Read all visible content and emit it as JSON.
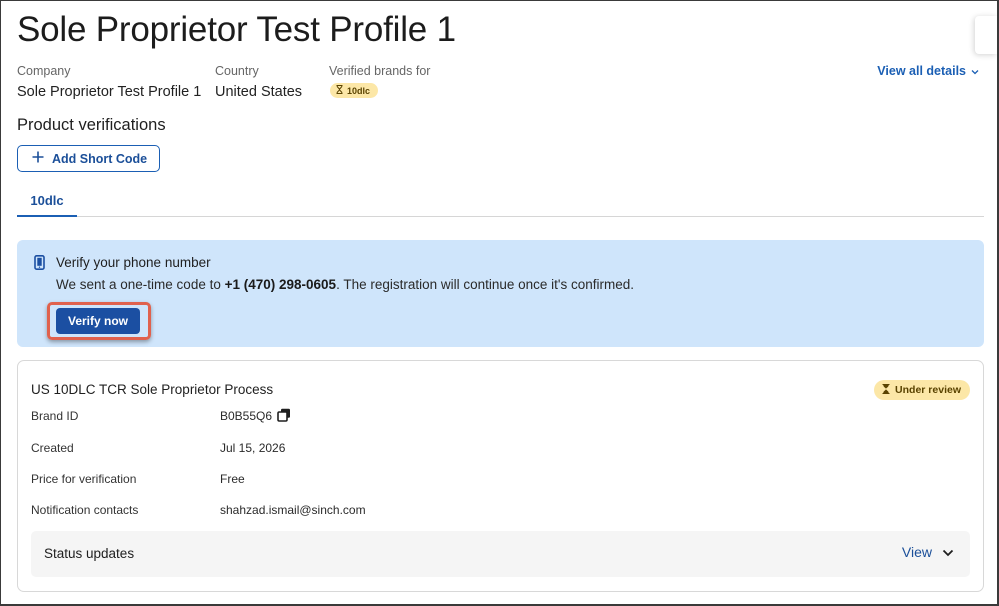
{
  "page": {
    "title": "Sole Proprietor Test Profile 1"
  },
  "meta": {
    "company_label": "Company",
    "company_value": "Sole Proprietor Test Profile 1",
    "country_label": "Country",
    "country_value": "United States",
    "brands_label": "Verified brands for",
    "brand_badge": "10dlc",
    "view_all": "View all details"
  },
  "verifications": {
    "title": "Product verifications",
    "add_button": "Add Short Code",
    "tabs": [
      {
        "label": "10dlc"
      }
    ]
  },
  "alert": {
    "title": "Verify your phone number",
    "body_prefix": "We sent a one-time code to ",
    "phone": "+1 (470) 298-0605",
    "body_suffix": ". The registration will continue once it's confirmed.",
    "button": "Verify now"
  },
  "card": {
    "title": "US 10DLC TCR Sole Proprietor Process",
    "status": "Under review",
    "rows": [
      {
        "label": "Brand ID",
        "value": "B0B55Q6"
      },
      {
        "label": "Created",
        "value": "Jul 15, 2026"
      },
      {
        "label": "Price for verification",
        "value": "Free"
      },
      {
        "label": "Notification contacts",
        "value": "shahzad.ismail@sinch.com"
      }
    ],
    "status_updates": {
      "title": "Status updates",
      "view": "View"
    }
  },
  "colors": {
    "accent": "#1b5fb4",
    "primary_button": "#1b4fa2",
    "alert_bg": "#cfe5fb",
    "warning_badge": "#fce7a7",
    "highlight": "#e0614d"
  },
  "icons": {
    "add": "plus-icon",
    "hourglass": "hourglass-icon",
    "phone": "phone-icon",
    "copy": "copy-icon",
    "chevron": "chevron-down-icon"
  }
}
